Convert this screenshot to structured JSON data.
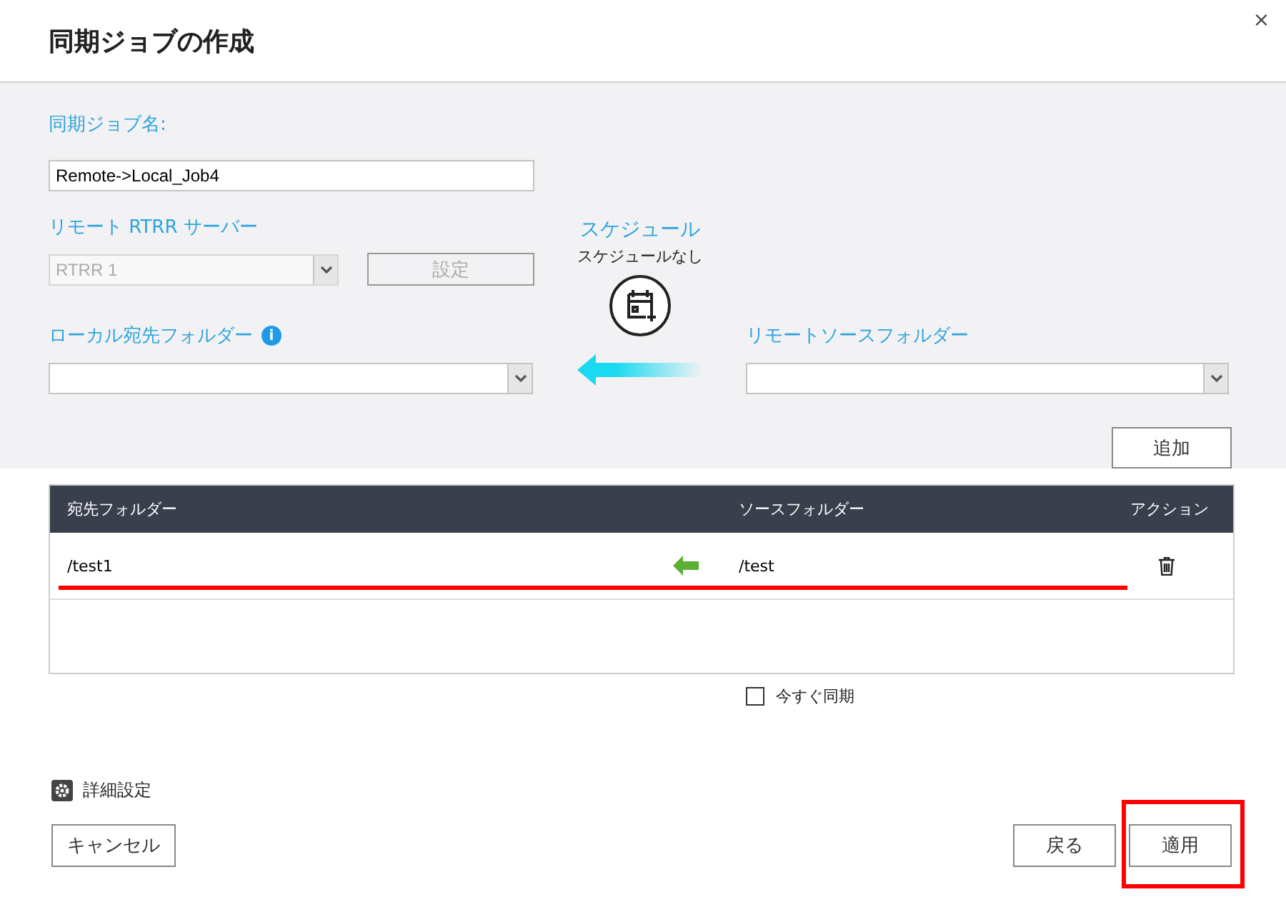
{
  "window": {
    "title": "同期ジョブの作成",
    "close": "×"
  },
  "form": {
    "job_name_label": "同期ジョブ名:",
    "job_name_value": "Remote->Local_Job4",
    "server_label": "リモート RTRR サーバー",
    "server_value": "RTRR 1",
    "server_disabled": true,
    "settings_button": "設定",
    "settings_disabled": true,
    "local_label": "ローカル宛先フォルダー",
    "local_info": "i",
    "schedule_label": "スケジュール",
    "schedule_value": "スケジュールなし",
    "remote_label": "リモートソースフォルダー",
    "add_button": "追加"
  },
  "table": {
    "columns": [
      "宛先フォルダー",
      "ソースフォルダー",
      "アクション"
    ],
    "rows": [
      {
        "destination": "/test1",
        "source": "/test",
        "highlighted": true
      }
    ]
  },
  "sync_now": {
    "label": "今すぐ同期",
    "checked": false
  },
  "advanced": "詳細設定",
  "buttons": [
    {
      "label": "キャンセル",
      "highlighted": false
    },
    {
      "label": "戻る",
      "highlighted": false
    },
    {
      "label": "適用",
      "highlighted": true
    }
  ]
}
